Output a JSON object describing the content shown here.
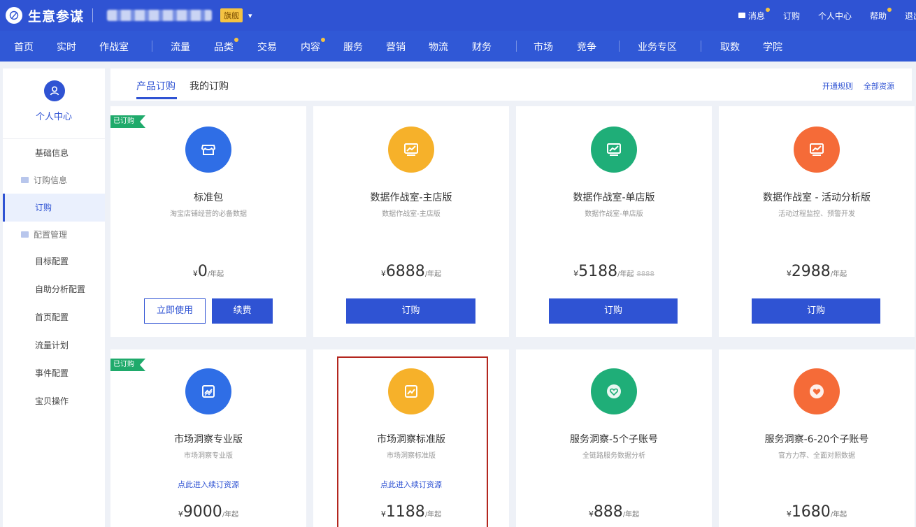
{
  "colors": {
    "primary": "#2f53d3",
    "ribbon": "#1faa6b",
    "blue": "#2f6ee6",
    "yellow": "#f6b12a",
    "green": "#1fae78",
    "orange": "#f56b38",
    "highlight": "#b3261e"
  },
  "header": {
    "app_title": "生意参谋",
    "shop_badge": "旗舰",
    "links": [
      {
        "label": "消息",
        "icon": "message-icon",
        "dot": true
      },
      {
        "label": "订购",
        "dot": false
      },
      {
        "label": "个人中心",
        "dot": false
      },
      {
        "label": "帮助",
        "dot": true
      },
      {
        "label": "退出",
        "dot": false
      }
    ]
  },
  "nav": {
    "items": [
      "首页",
      "实时",
      "作战室",
      "流量",
      "品类",
      "交易",
      "内容",
      "服务",
      "营销",
      "物流",
      "财务",
      "市场",
      "竞争",
      "业务专区",
      "取数",
      "学院"
    ]
  },
  "sidebar": {
    "title": "个人中心",
    "items": [
      {
        "label": "基础信息",
        "type": "item"
      },
      {
        "label": "订购信息",
        "type": "group"
      },
      {
        "label": "订购",
        "type": "item",
        "active": true
      },
      {
        "label": "配置管理",
        "type": "group"
      },
      {
        "label": "目标配置",
        "type": "item"
      },
      {
        "label": "自助分析配置",
        "type": "item"
      },
      {
        "label": "首页配置",
        "type": "item"
      },
      {
        "label": "流量计划",
        "type": "item"
      },
      {
        "label": "事件配置",
        "type": "item"
      },
      {
        "label": "宝贝操作",
        "type": "item"
      }
    ]
  },
  "tabs": {
    "items": [
      "产品订购",
      "我的订购"
    ],
    "links": [
      "开通规则",
      "全部资源"
    ]
  },
  "products": [
    {
      "title": "标准包",
      "subtitle": "淘宝店铺经营的必备数据",
      "currency": "¥",
      "price": "0",
      "unit": "/年起",
      "ribbon": "已订购",
      "icon": "store-icon",
      "color": "blue",
      "buttons": [
        "立即使用",
        "续费"
      ]
    },
    {
      "title": "数据作战室-主店版",
      "subtitle": "数据作战室-主店版",
      "currency": "¥",
      "price": "6888",
      "unit": "/年起",
      "icon": "chart-screen-icon",
      "color": "yellow",
      "buttons": [
        "订购"
      ]
    },
    {
      "title": "数据作战室-单店版",
      "subtitle": "数据作战室-单店版",
      "currency": "¥",
      "price": "5188",
      "unit": "/年起",
      "original": "8888",
      "icon": "chart-screen-icon",
      "color": "green",
      "buttons": [
        "订购"
      ]
    },
    {
      "title": "数据作战室 - 活动分析版",
      "subtitle": "活动过程监控、预警开发",
      "currency": "¥",
      "price": "2988",
      "unit": "/年起",
      "icon": "chart-screen-icon",
      "color": "orange",
      "buttons": [
        "订购"
      ]
    },
    {
      "title": "市场洞察专业版",
      "subtitle": "市场洞察专业版",
      "currency": "¥",
      "price": "9000",
      "unit": "/年起",
      "ribbon": "已订购",
      "icon": "trend-chart-icon",
      "color": "blue",
      "link": "点此进入续订资源"
    },
    {
      "title": "市场洞察标准版",
      "subtitle": "市场洞察标准版",
      "currency": "¥",
      "price": "1188",
      "unit": "/年起",
      "icon": "trend-chart-icon",
      "color": "yellow",
      "link": "点此进入续订资源"
    },
    {
      "title": "服务洞察-5个子账号",
      "subtitle": "全链路服务数据分析",
      "currency": "¥",
      "price": "888",
      "unit": "/年起",
      "icon": "heart-badge-icon",
      "color": "green"
    },
    {
      "title": "服务洞察-6-20个子账号",
      "subtitle": "官方力荐、全面对照数据",
      "currency": "¥",
      "price": "1680",
      "unit": "/年起",
      "icon": "heart-badge-icon",
      "color": "orange"
    }
  ]
}
